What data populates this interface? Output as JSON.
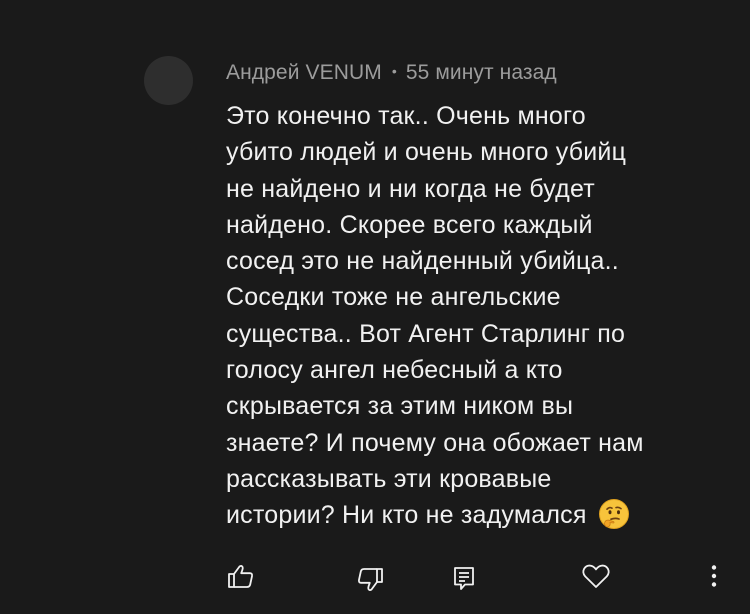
{
  "comment": {
    "author": "Андрей VENUM",
    "separator": "•",
    "timestamp": "55 минут назад",
    "text": "Это конечно так.. Очень много\nубито людей и очень много убийц\nне найдено и ни когда не будет\nнайдено. Скорее всего каждый\nсосед это не найденный убийца..\nСоседки тоже не ангельские\nсущества.. Вот Агент Старлинг по\nголосу ангел небесный а кто\nскрывается за этим ником вы\nзнаете? И почему она обожает нам\nрассказывать эти кровавые\nистории? Ни кто не задумался",
    "emoji": "thinking-face-icon"
  },
  "actions": {
    "like": "thumbs-up-icon",
    "dislike": "thumbs-down-icon",
    "reply": "reply-icon",
    "heart": "heart-icon",
    "more": "more-vertical-icon"
  },
  "colors": {
    "background": "#1a1a1a",
    "text": "#f1f1f1",
    "meta": "#9c9c9c",
    "avatar": "#2e2e2e"
  }
}
